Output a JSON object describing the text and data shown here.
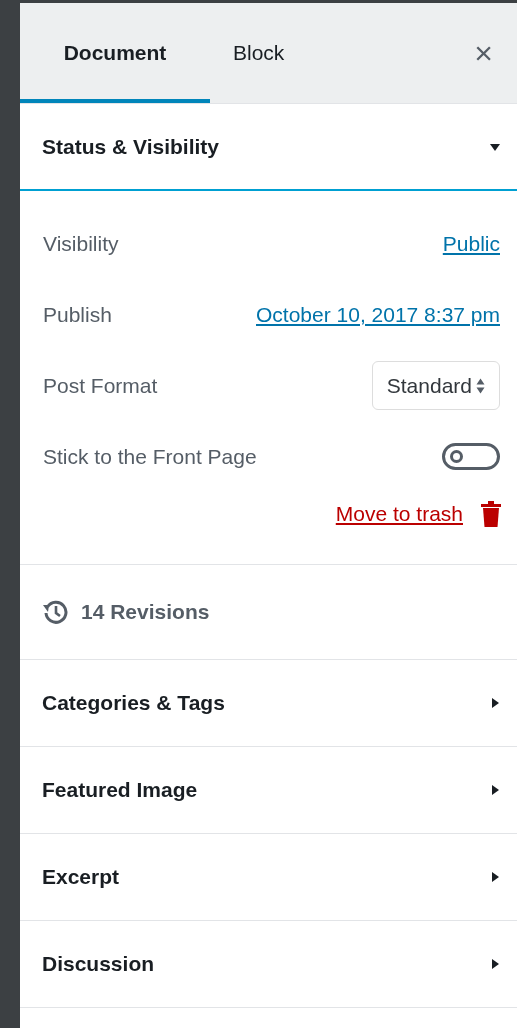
{
  "tabs": [
    {
      "label": "Document",
      "selected": true
    },
    {
      "label": "Block",
      "selected": false
    }
  ],
  "close_button": {
    "label": "×"
  },
  "status_panel": {
    "title": "Status & Visibility",
    "expanded": true,
    "rows": [
      {
        "kind": "link",
        "label": "Visibility",
        "value": "Public"
      },
      {
        "kind": "link",
        "label": "Publish",
        "value": "October 10, 2017 8:37 pm"
      },
      {
        "kind": "select",
        "label": "Post Format",
        "value": "Standard"
      },
      {
        "kind": "toggle",
        "label": "Stick to the Front Page",
        "on": false
      }
    ],
    "trash_link": "Move to trash"
  },
  "revisions": "14 Revisions",
  "panels": [
    {
      "title": "Categories & Tags",
      "expanded": false
    },
    {
      "title": "Featured Image",
      "expanded": false
    },
    {
      "title": "Excerpt",
      "expanded": false
    },
    {
      "title": "Discussion",
      "expanded": false
    }
  ]
}
